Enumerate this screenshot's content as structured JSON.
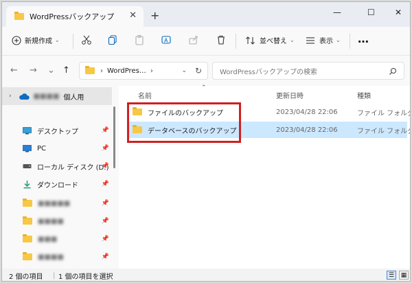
{
  "window": {
    "tab_title": "WordPressバックアップ",
    "tab_close": "✕",
    "new_tab": "+",
    "minimize": "—",
    "maximize": "☐",
    "close": "✕"
  },
  "toolbar": {
    "new_label": "新規作成",
    "sort_label": "並べ替え",
    "view_label": "表示",
    "more": "…"
  },
  "address": {
    "segment": "WordPres…",
    "separator": "›",
    "search_placeholder": "WordPressバックアップの検索"
  },
  "sidebar": {
    "cloud_label": "個人用",
    "items": [
      {
        "label": "デスクトップ",
        "icon": "desktop-icon"
      },
      {
        "label": "PC",
        "icon": "pc-icon"
      },
      {
        "label": "ローカル ディスク (D:)",
        "icon": "drive-icon"
      },
      {
        "label": "ダウンロード",
        "icon": "download-icon"
      }
    ],
    "blurred_items": [
      "■■■■■",
      "■■■■",
      "■■■",
      "■■■■"
    ]
  },
  "columns": {
    "name": "名前",
    "date": "更新日時",
    "type": "種類"
  },
  "files": [
    {
      "name": "ファイルのバックアップ",
      "date": "2023/04/28 22:06",
      "type": "ファイル フォルダー"
    },
    {
      "name": "データベースのバックアップ",
      "date": "2023/04/28 22:06",
      "type": "ファイル フォルダー"
    }
  ],
  "status": {
    "item_count": "2 個の項目",
    "selected": "1 個の項目を選択"
  },
  "colors": {
    "accent": "#0067c0",
    "selection": "#cce8ff",
    "highlight_border": "#d01f1f",
    "folder": "#f7c846"
  }
}
